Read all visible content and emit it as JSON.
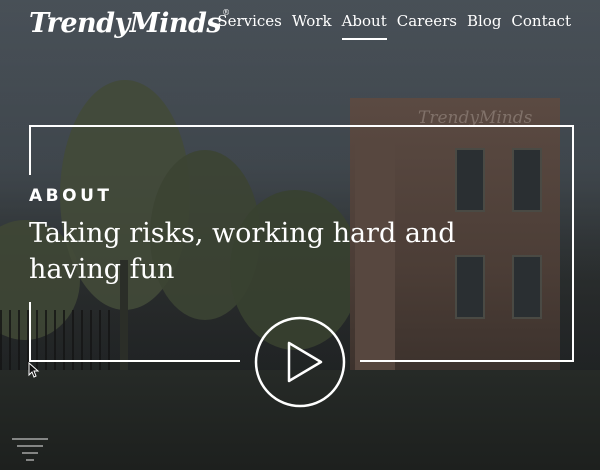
{
  "header": {
    "logo_text": "TrendyMinds",
    "logo_mark": "®",
    "nav": [
      {
        "label": "Services",
        "active": false
      },
      {
        "label": "Work",
        "active": false
      },
      {
        "label": "About",
        "active": true
      },
      {
        "label": "Careers",
        "active": false
      },
      {
        "label": "Blog",
        "active": false
      },
      {
        "label": "Contact",
        "active": false
      }
    ]
  },
  "hero": {
    "section_label": "ABOUT",
    "headline": "Taking risks, working hard and having fun",
    "building_sign": "TrendyMinds",
    "play_icon": "play-icon",
    "menu_icon": "hamburger-menu-icon"
  },
  "colors": {
    "text": "#ffffff",
    "overlay": "#2a2d30"
  }
}
